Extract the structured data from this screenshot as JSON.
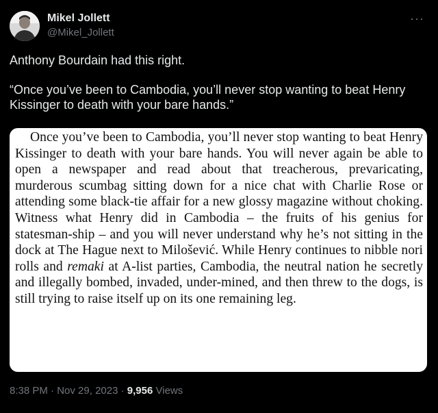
{
  "author": {
    "display_name": "Mikel Jollett",
    "handle": "@Mikel_Jollett",
    "avatar_icon": "person-avatar"
  },
  "more_icon": "ellipsis-icon",
  "more_glyph": "···",
  "tweet": {
    "line1": "Anthony Bourdain had this right.",
    "line2": "“Once you’ve been to Cambodia, you’ll never stop wanting to beat Henry Kissinger to death with your bare hands.”"
  },
  "book_excerpt": {
    "before_italic": "Once you’ve been to Cambodia, you’ll never stop wanting to beat Henry Kissinger to death with your bare hands. You will never again be able to open a newspaper and read about that treacherous, prevaricating, murderous scumbag sitting down for a nice chat with Charlie Rose or attending some black-tie affair for a new glossy magazine without choking. Witness what Henry did in Cambodia – the fruits of his genius for statesman-ship – and you will never understand why he’s not sitting in the dock at The Hague next to Milošević. While Henry continues to nibble nori rolls and ",
    "italic": "remaki",
    "after_italic": " at A-list parties, Cambodia, the neutral nation he secretly and illegally bombed, invaded, under-mined, and then threw to the dogs, is still trying to raise itself up on its one remaining leg."
  },
  "meta": {
    "time": "8:38 PM",
    "sep1": " · ",
    "date": "Nov 29, 2023",
    "sep2": " · ",
    "views_count": "9,956",
    "views_label": " Views"
  }
}
